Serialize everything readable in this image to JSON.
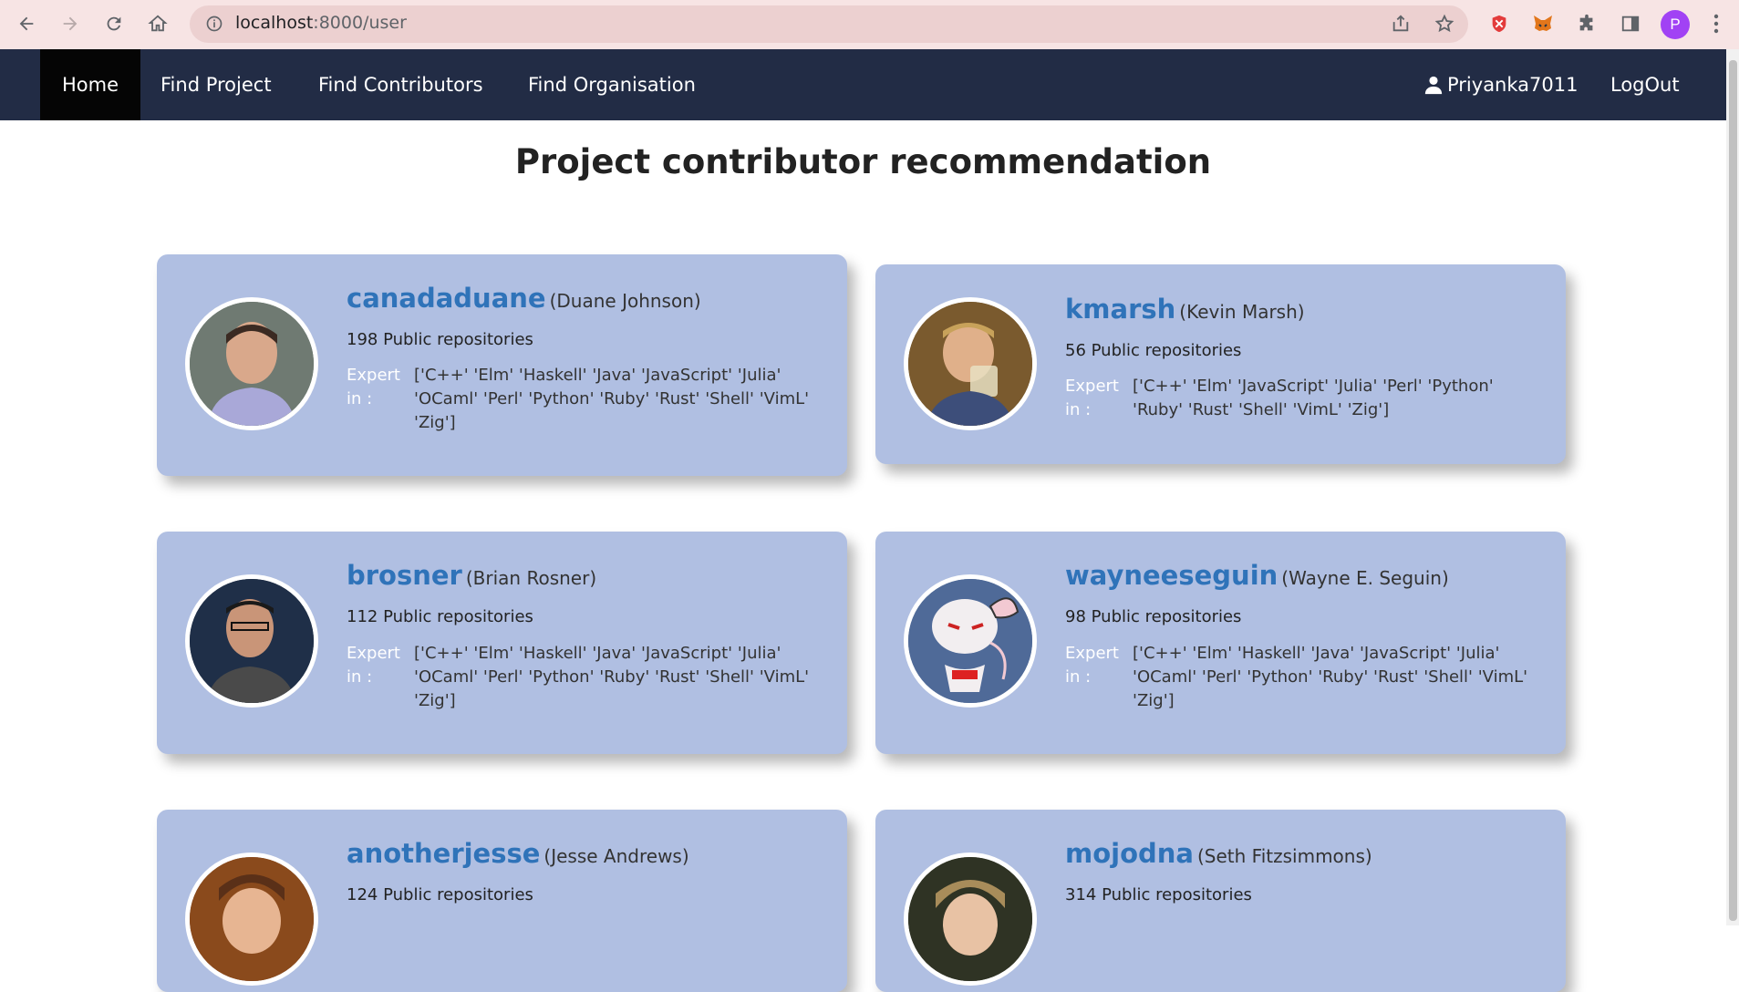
{
  "browser": {
    "url_host": "localhost",
    "url_path": ":8000/user",
    "profile_initial": "P"
  },
  "nav": {
    "home": "Home",
    "find_project": "Find Project",
    "find_contributors": "Find Contributors",
    "find_organisation": "Find Organisation",
    "username": "Priyanka7011",
    "logout": "LogOut"
  },
  "page_title": "Project contributor recommendation",
  "contributors": [
    {
      "username": "canadaduane",
      "fullname": "(Duane Johnson)",
      "repos": "198 Public repositories",
      "expert_label": "Expert in :",
      "expert": "['C++' 'Elm' 'Haskell' 'Java' 'JavaScript' 'Julia' 'OCaml' 'Perl' 'Python' 'Ruby' 'Rust' 'Shell' 'VimL' 'Zig']"
    },
    {
      "username": "kmarsh",
      "fullname": "(Kevin Marsh)",
      "repos": "56 Public repositories",
      "expert_label": "Expert in :",
      "expert": "['C++' 'Elm' 'JavaScript' 'Julia' 'Perl' 'Python' 'Ruby' 'Rust' 'Shell' 'VimL' 'Zig']"
    },
    {
      "username": "brosner",
      "fullname": "(Brian Rosner)",
      "repos": "112 Public repositories",
      "expert_label": "Expert in :",
      "expert": "['C++' 'Elm' 'Haskell' 'Java' 'JavaScript' 'Julia' 'OCaml' 'Perl' 'Python' 'Ruby' 'Rust' 'Shell' 'VimL' 'Zig']"
    },
    {
      "username": "wayneeseguin",
      "fullname": "(Wayne E. Seguin)",
      "repos": "98 Public repositories",
      "expert_label": "Expert in :",
      "expert": "['C++' 'Elm' 'Haskell' 'Java' 'JavaScript' 'Julia' 'OCaml' 'Perl' 'Python' 'Ruby' 'Rust' 'Shell' 'VimL' 'Zig']"
    },
    {
      "username": "anotherjesse",
      "fullname": "(Jesse Andrews)",
      "repos": "124 Public repositories"
    },
    {
      "username": "mojodna",
      "fullname": "(Seth Fitzsimmons)",
      "repos": "314 Public repositories"
    }
  ]
}
